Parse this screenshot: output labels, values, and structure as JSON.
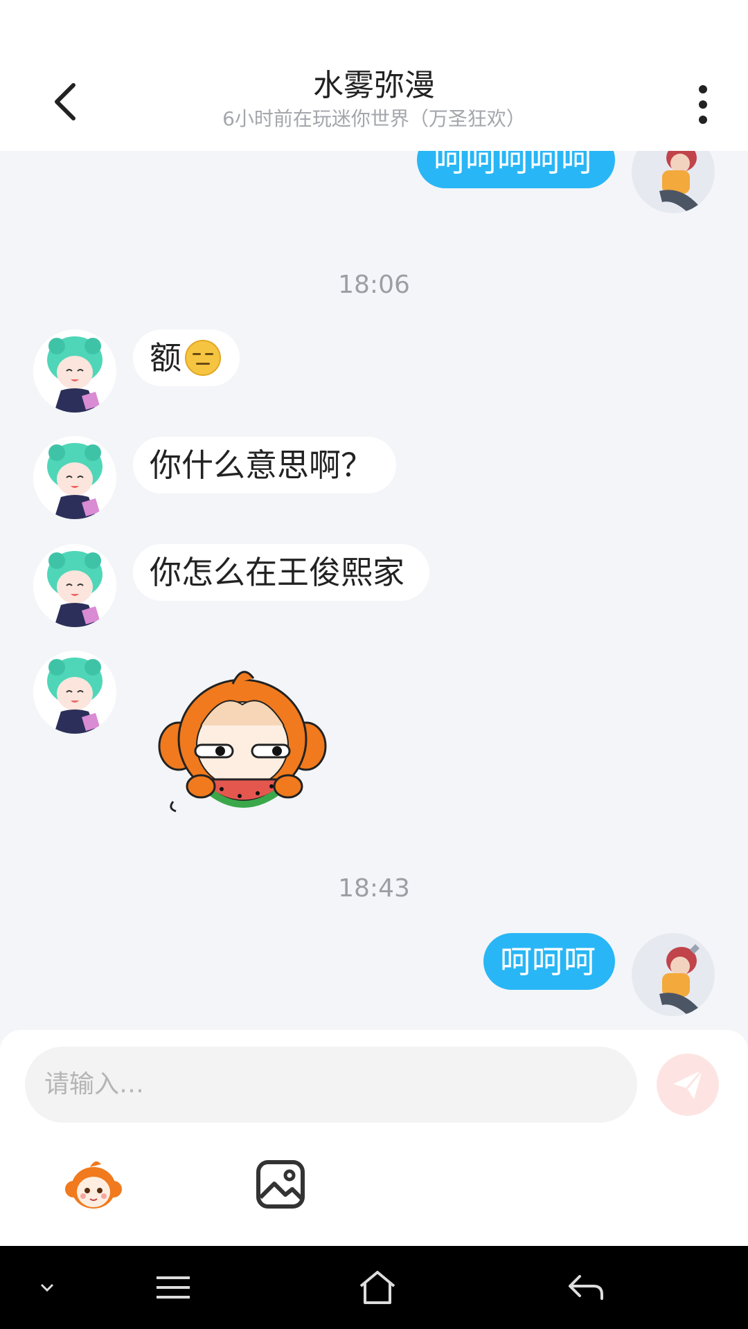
{
  "header": {
    "title": "水雾弥漫",
    "subtitle": "6小时前在玩迷你世界（万圣狂欢）"
  },
  "messages": {
    "top_out_text": "呵呵呵呵呵",
    "time_1": "18:06",
    "in_1_text": "额",
    "in_1_emoji": "expressionless-face-emoji",
    "in_2_text": "你什么意思啊？",
    "in_3_text": "你怎么在王俊熙家",
    "in_4_sticker": "monkey-eating-watermelon-sticker",
    "time_2": "18:43",
    "out_2_text": "呵呵呵"
  },
  "composer": {
    "placeholder": "请输入…"
  },
  "colors": {
    "outgoing_bubble": "#29b6f6",
    "incoming_bubble": "#ffffff",
    "background": "#f3f5f8",
    "send_button": "#fde4e2"
  },
  "icons": {
    "back": "chevron-left-icon",
    "more": "more-vertical-icon",
    "send": "paper-plane-icon",
    "sticker": "monkey-sticker-icon",
    "image": "image-icon",
    "nav_collapse": "chevron-down-icon",
    "nav_menu": "menu-icon",
    "nav_home": "home-icon",
    "nav_back": "back-arrow-icon"
  }
}
